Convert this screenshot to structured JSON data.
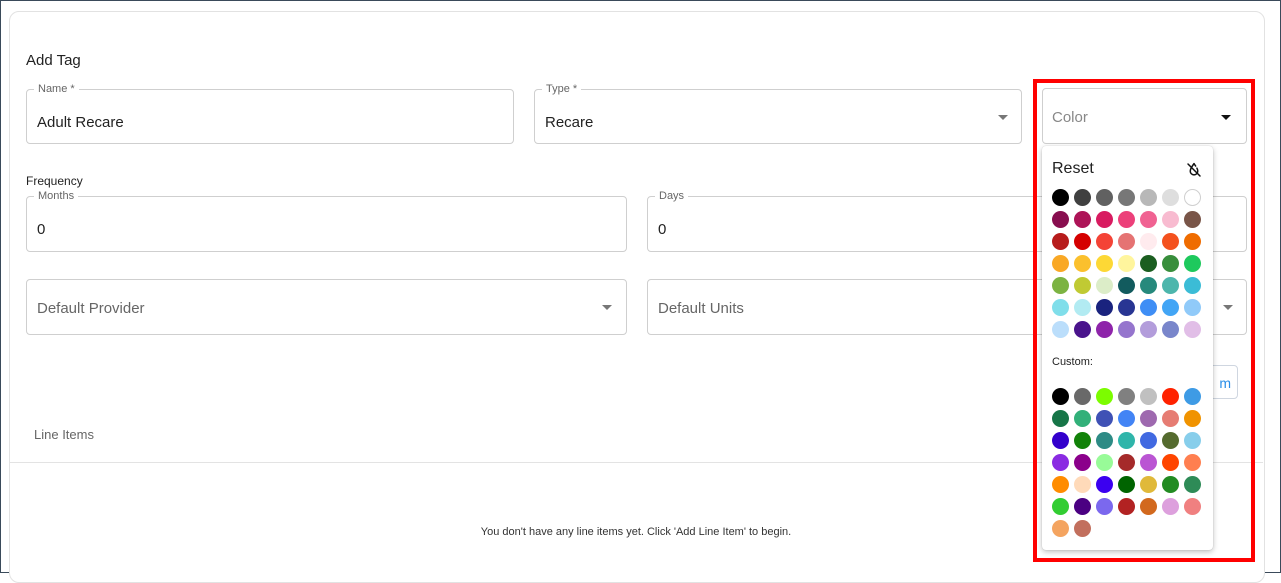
{
  "form": {
    "title": "Add Tag",
    "name": {
      "label": "Name *",
      "value": "Adult Recare"
    },
    "type": {
      "label": "Type *",
      "value": "Recare"
    },
    "color": {
      "placeholder": "Color"
    },
    "frequency": {
      "label": "Frequency",
      "months": {
        "label": "Months",
        "value": "0"
      },
      "days": {
        "label": "Days",
        "value": "0"
      }
    },
    "default_provider": {
      "placeholder": "Default Provider"
    },
    "default_units": {
      "placeholder": "Default Units"
    },
    "add_line_item_partial": "m"
  },
  "line_items": {
    "label": "Line Items",
    "empty_message": "You don't have any line items yet. Click 'Add Line Item' to begin."
  },
  "color_picker": {
    "reset_label": "Reset",
    "custom_label": "Custom:",
    "preset_colors": [
      [
        "#000000",
        "#404040",
        "#616161",
        "#777777",
        "#b8b8b8",
        "#dedede",
        "#ffffff"
      ],
      [
        "#880e4f",
        "#ad1457",
        "#d81b60",
        "#ec407a",
        "#f06292",
        "#f8bbd0",
        "#795548"
      ],
      [
        "#b71c1c",
        "#d50000",
        "#f44336",
        "#e57373",
        "#ffebee",
        "#f4511e",
        "#ef6c00"
      ],
      [
        "#f9a825",
        "#fbc02d",
        "#fdd835",
        "#fff59d",
        "#1b5e20",
        "#388e3c",
        "#1ec95d"
      ],
      [
        "#7cb342",
        "#c0ca33",
        "#dcedc8",
        "#125b5e",
        "#26897c",
        "#4db6ac",
        "#3bbcd6"
      ],
      [
        "#80deea",
        "#b2ebf2",
        "#1a237e",
        "#283593",
        "#3f8ef5",
        "#42a5f5",
        "#90caf9"
      ],
      [
        "#bbdefb",
        "#4a148c",
        "#8e24aa",
        "#9575cd",
        "#b39ddb",
        "#7986cb",
        "#e1bee7"
      ]
    ],
    "custom_colors": [
      [
        "#000000",
        "#696969",
        "#7cfc00",
        "#808080",
        "#c0c0c0",
        "#ff2200",
        "#3e9be5"
      ],
      [
        "#167547",
        "#32b079",
        "#3f51b5",
        "#4284f5",
        "#9e69af",
        "#e67c73",
        "#f09300"
      ],
      [
        "#3300cc",
        "#128209",
        "#2d8b85",
        "#2fb5aa",
        "#4169e1",
        "#556b2f",
        "#87ceeb"
      ],
      [
        "#8a2be2",
        "#8b008b",
        "#98fb98",
        "#a52a2a",
        "#ba55d3",
        "#ff4500",
        "#ff7f50"
      ],
      [
        "#ff8c00",
        "#ffdab9",
        "#3b00f0",
        "#006400",
        "#e0b93a",
        "#228b22",
        "#2e8b57"
      ],
      [
        "#32cd32",
        "#4b0082",
        "#7b68ee",
        "#b22222",
        "#d2691e",
        "#dda0dd",
        "#f08080"
      ],
      [
        "#f4a460",
        "#c26f5d"
      ]
    ]
  }
}
